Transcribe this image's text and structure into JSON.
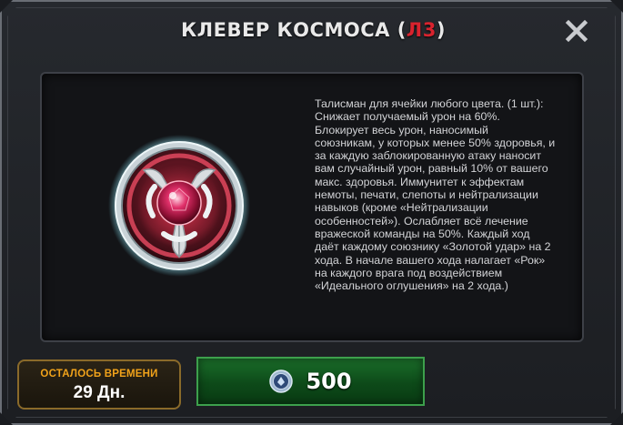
{
  "window": {
    "title_main": "КЛЕВЕР КОСМОСА",
    "title_paren_open": "(",
    "title_tier": "Л3",
    "title_paren_close": ")",
    "close_icon": "close-icon"
  },
  "item": {
    "icon": "space-clover-talisman-icon",
    "description": "Талисман для ячейки любого цвета. (1 шт.):\nСнижает получаемый урон на 60%.\nБлокирует весь урон, наносимый\nсоюзникам, у которых менее 50% здоровья, и\nза каждую заблокированную атаку наносит\nвам случайный урон, равный 10% от вашего\nмакс. здоровья. Иммунитет к эффектам\nнемоты, печати, слепоты и нейтрализации\nнавыков (кроме «Нейтрализации\nособенностей»). Ослабляет всё лечение\nвражеской команды на 50%. Каждый ход\nдаёт каждому союзнику «Золотой удар» на 2\nхода. В начале вашего хода налагает «Рок»\nна каждого врага под воздействием\n«Идеального оглушения» на 2 хода.)"
  },
  "timer": {
    "label": "ОСТАЛОСЬ ВРЕМЕНИ",
    "value": "29 Дн."
  },
  "purchase": {
    "currency_icon": "crystal-currency-icon",
    "price": "500"
  },
  "colors": {
    "title_tier": "#d8232e",
    "timer_label": "#f0a21a",
    "buy_button": "#0d4a19"
  }
}
